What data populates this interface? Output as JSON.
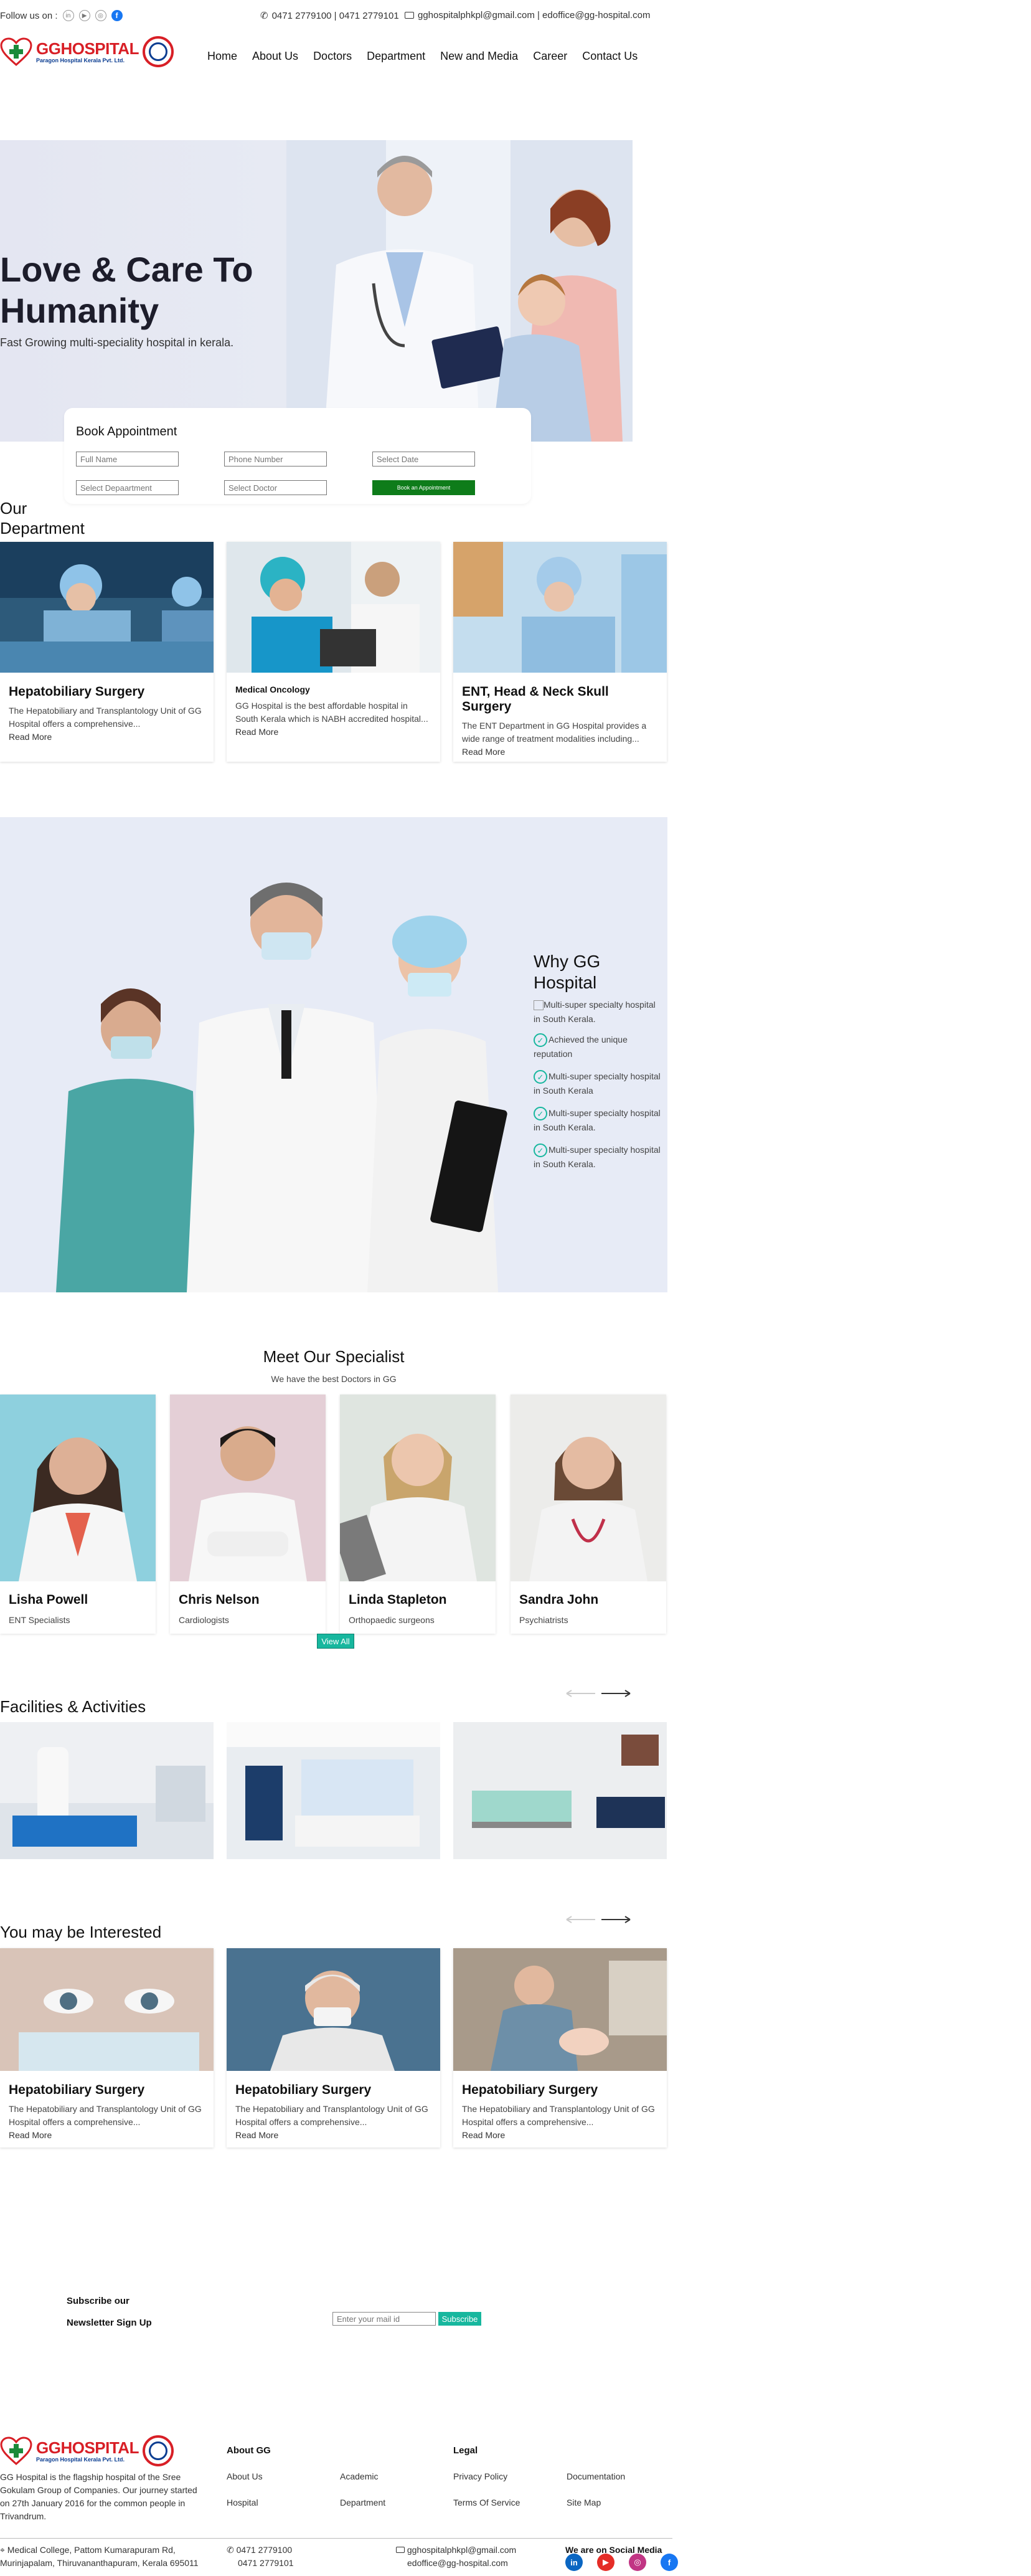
{
  "topbar": {
    "follow_label": "Follow us on :",
    "phones": "0471 2779100 | 0471 2779101",
    "emails": "gghospitalphkpl@gmail.com | edoffice@gg-hospital.com"
  },
  "logo": {
    "name": "GGHOSPITAL",
    "sub": "Paragon Hospital Kerala Pvt. Ltd."
  },
  "nav": [
    "Home",
    "About Us",
    "Doctors",
    "Department",
    "New and Media",
    "Career",
    "Contact Us"
  ],
  "hero": {
    "title": "Love & Care To Humanity",
    "subtitle": "Fast Growing multi-speciality hospital in kerala."
  },
  "booking": {
    "title": "Book Appointment",
    "full_name_ph": "Full Name",
    "phone_ph": "Phone Number",
    "date_ph": "Select Date",
    "department_ph": "Select Depaartment",
    "doctor_ph": "Select Doctor",
    "button": "Book an Appointment"
  },
  "departments": {
    "title": "Our Department",
    "cards": [
      {
        "title": "Hepatobiliary Surgery",
        "desc": "The Hepatobiliary and Transplantology Unit of GG Hospital offers a comprehensive...",
        "read_more": "Read More"
      },
      {
        "title": "Medical Oncology",
        "desc": "GG Hospital is the best affordable hospital in South Kerala which is NABH accredited hospital...",
        "read_more": "Read More"
      },
      {
        "title": "ENT, Head & Neck Skull Surgery",
        "desc": "The ENT Department in GG Hospital provides a wide range of treatment modalities including...",
        "read_more": "Read More"
      }
    ]
  },
  "why": {
    "title": "Why GG Hospital",
    "items": [
      "Multi-super specialty hospital in South Kerala.",
      "Achieved the unique reputation",
      "Multi-super specialty hospital in South Kerala",
      "Multi-super specialty hospital in South Kerala.",
      "Multi-super specialty hospital in South Kerala."
    ]
  },
  "specialists": {
    "title": "Meet Our Specialist",
    "subtitle": "We have the best Doctors in GG",
    "doctors": [
      {
        "name": "Lisha Powell",
        "role": "ENT Specialists"
      },
      {
        "name": "Chris Nelson",
        "role": "Cardiologists"
      },
      {
        "name": "Linda Stapleton",
        "role": "Orthopaedic surgeons"
      },
      {
        "name": "Sandra John",
        "role": "Psychiatrists"
      }
    ],
    "view_all": "View All"
  },
  "facilities": {
    "title": "Facilities & Activities"
  },
  "interested": {
    "title": "You may be Interested",
    "cards": [
      {
        "title": "Hepatobiliary Surgery",
        "desc": "The Hepatobiliary and Transplantology Unit of GG Hospital offers a comprehensive...",
        "read_more": "Read More"
      },
      {
        "title": "Hepatobiliary Surgery",
        "desc": "The Hepatobiliary and Transplantology Unit of GG Hospital offers a comprehensive...",
        "read_more": "Read More"
      },
      {
        "title": "Hepatobiliary Surgery",
        "desc": "The Hepatobiliary and Transplantology Unit of GG Hospital offers a comprehensive...",
        "read_more": "Read More"
      }
    ]
  },
  "subscribe": {
    "label1": "Subscribe our",
    "label2": "Newsletter Sign Up",
    "email_ph": "Enter your mail id",
    "button": "Subscribe"
  },
  "footer": {
    "about": "GG Hospital is the flagship hospital of the Sree Gokulam Group of Companies. Our journey started on 27th January 2016 for the common people in Trivandrum.",
    "about_title": "About GG",
    "about_links": [
      "About Us",
      "Academic",
      "Hospital",
      "Department"
    ],
    "legal_title": "Legal",
    "legal_links": [
      "Privacy Policy",
      "Documentation",
      "Terms Of Service",
      "Site Map"
    ],
    "address": "Medical College, Pattom Kumarapuram Rd, Murinjapalam, Thiruvananthapuram, Kerala 695011",
    "phone1": "0471 2779100",
    "phone2": "0471 2779101",
    "email1": "gghospitalphkpl@gmail.com",
    "email2": "edoffice@gg-hospital.com",
    "social_title": "We are on Social Media"
  },
  "colors": {
    "brand_red": "#d81f26",
    "brand_blue": "#0b3d91",
    "accent_teal": "#17b79e",
    "book_green": "#0e7c1a"
  }
}
